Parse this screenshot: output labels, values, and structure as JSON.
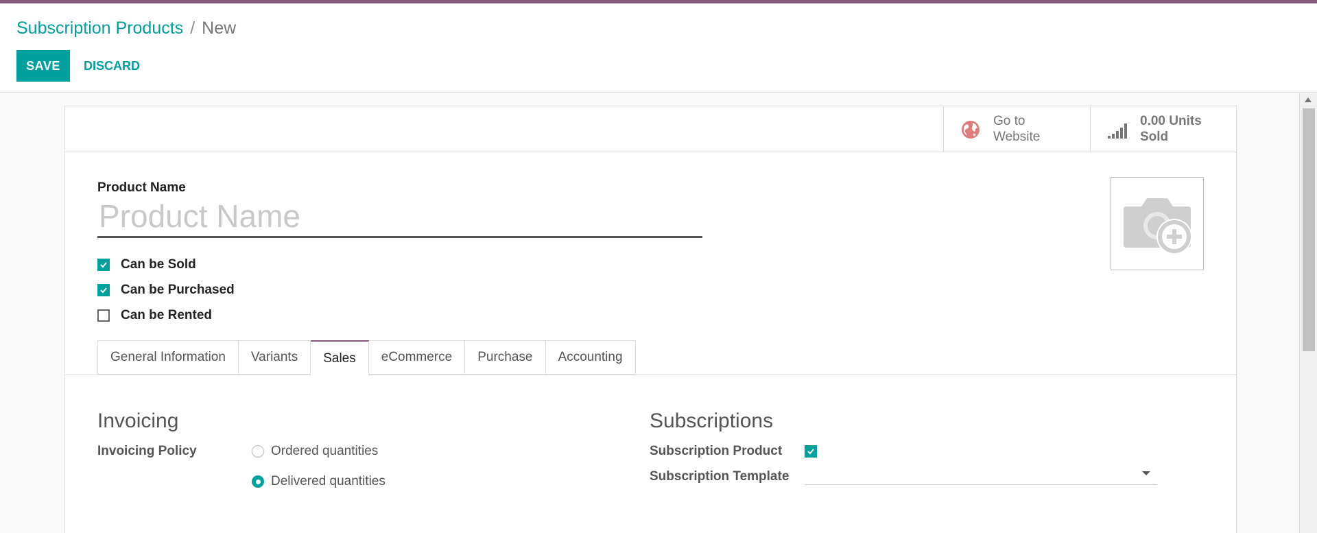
{
  "breadcrumb": {
    "parent": "Subscription Products",
    "separator": "/",
    "current": "New"
  },
  "toolbar": {
    "save_label": "SAVE",
    "discard_label": "DISCARD"
  },
  "stat_buttons": [
    {
      "icon": "globe-icon",
      "line1": "Go to",
      "line2": "Website"
    },
    {
      "icon": "bar-chart-icon",
      "line1": "0.00 Units",
      "line2": "Sold"
    }
  ],
  "product": {
    "name_label": "Product Name",
    "name_placeholder": "Product Name",
    "name_value": ""
  },
  "checkboxes": [
    {
      "label": "Can be Sold",
      "checked": true
    },
    {
      "label": "Can be Purchased",
      "checked": true
    },
    {
      "label": "Can be Rented",
      "checked": false
    }
  ],
  "tabs": [
    {
      "label": "General Information",
      "active": false
    },
    {
      "label": "Variants",
      "active": false
    },
    {
      "label": "Sales",
      "active": true
    },
    {
      "label": "eCommerce",
      "active": false
    },
    {
      "label": "Purchase",
      "active": false
    },
    {
      "label": "Accounting",
      "active": false
    }
  ],
  "invoicing": {
    "title": "Invoicing",
    "policy_label": "Invoicing Policy",
    "options": [
      {
        "label": "Ordered quantities",
        "selected": false
      },
      {
        "label": "Delivered quantities",
        "selected": true
      }
    ]
  },
  "subscriptions": {
    "title": "Subscriptions",
    "product_label": "Subscription Product",
    "product_checked": true,
    "template_label": "Subscription Template",
    "template_value": ""
  },
  "colors": {
    "accent": "#00a09d",
    "brand": "#875a7b",
    "globe": "#e27c7c"
  }
}
